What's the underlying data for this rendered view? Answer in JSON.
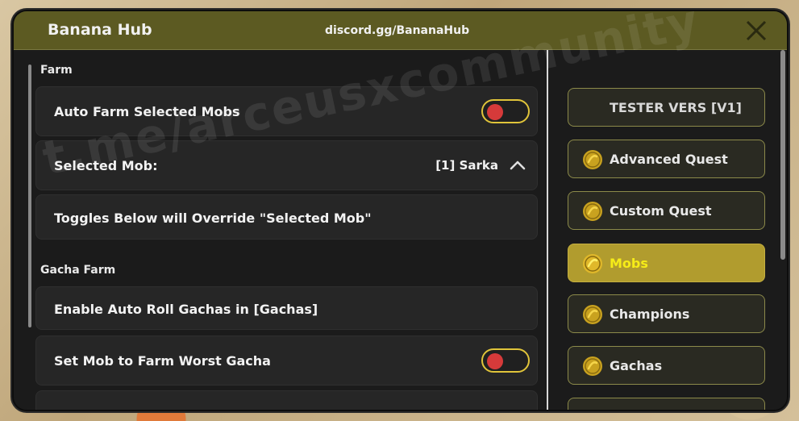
{
  "window": {
    "title": "Banana Hub",
    "discord": "discord.gg/BananaHub"
  },
  "farm": {
    "section_label": "Farm",
    "auto_farm_label": "Auto Farm Selected Mobs",
    "auto_farm_enabled": false,
    "selected_mob_label": "Selected Mob:",
    "selected_mob_value": "[1] Sarka",
    "override_note": "Toggles Below will Override \"Selected Mob\""
  },
  "gacha_farm": {
    "section_label": "Gacha Farm",
    "enable_auto_roll_label": "Enable Auto Roll Gachas in [Gachas]",
    "worst_gacha_label": "Set Mob to Farm Worst Gacha",
    "worst_gacha_enabled": false
  },
  "tabs": [
    {
      "label": "TESTER VERS [V1]",
      "icon": "none",
      "active": false
    },
    {
      "label": "Advanced Quest",
      "icon": "banana-coin-icon",
      "active": false
    },
    {
      "label": "Custom Quest",
      "icon": "banana-coin-icon",
      "active": false
    },
    {
      "label": "Mobs",
      "icon": "banana-coin-icon",
      "active": true
    },
    {
      "label": "Champions",
      "icon": "banana-coin-icon",
      "active": false
    },
    {
      "label": "Gachas",
      "icon": "banana-coin-icon",
      "active": false
    }
  ],
  "watermark": "t.me/arceusxcommunity",
  "colors": {
    "titlebar": "#5c5a22",
    "accent": "#e0c43a",
    "active_tab": "#b19c2e",
    "active_tab_text": "#f6ec18",
    "toggle_off_knob": "#d63a3a"
  }
}
